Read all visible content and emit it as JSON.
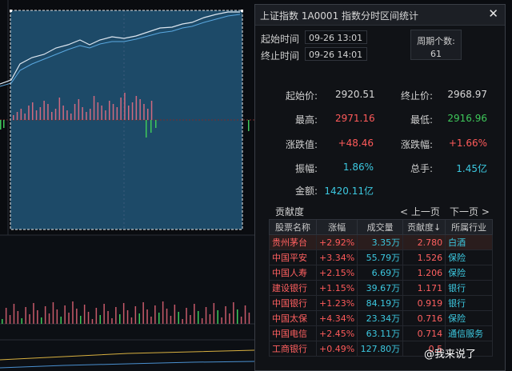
{
  "panel": {
    "title": "上证指数  1A0001  指数分时区间统计",
    "close": "✕",
    "start_label": "起始时间",
    "start_value": "09-26 13:01",
    "end_label": "终止时间",
    "end_value": "09-26 14:01",
    "period_label": "周期个数:",
    "period_value": "61"
  },
  "stats": {
    "start_price_label": "起始价:",
    "start_price": "2920.51",
    "end_price_label": "终止价:",
    "end_price": "2968.97",
    "high_label": "最高:",
    "high": "2971.16",
    "low_label": "最低:",
    "low": "2916.96",
    "change_label": "涨跌值:",
    "change": "+48.46",
    "pct_label": "涨跌幅:",
    "pct": "+1.66%",
    "amp_label": "振幅:",
    "amp": "1.86%",
    "turnover_label": "总手:",
    "turnover": "1.45亿",
    "amount_label": "金额:",
    "amount": "1420.11亿"
  },
  "contrib": {
    "tab": "贡献度",
    "prev": "< 上一页",
    "next": "下一页 >",
    "headers": [
      "股票名称",
      "涨幅",
      "成交量",
      "贡献度↓",
      "所属行业"
    ],
    "rows": [
      {
        "name": "贵州茅台",
        "pct": "+2.92%",
        "vol": "3.35万",
        "contrib": "2.780",
        "ind": "白酒"
      },
      {
        "name": "中国平安",
        "pct": "+3.34%",
        "vol": "55.79万",
        "contrib": "1.526",
        "ind": "保险"
      },
      {
        "name": "中国人寿",
        "pct": "+2.15%",
        "vol": "6.69万",
        "contrib": "1.206",
        "ind": "保险"
      },
      {
        "name": "建设银行",
        "pct": "+1.15%",
        "vol": "39.67万",
        "contrib": "1.171",
        "ind": "银行"
      },
      {
        "name": "中国银行",
        "pct": "+1.23%",
        "vol": "84.19万",
        "contrib": "0.919",
        "ind": "银行"
      },
      {
        "name": "中国太保",
        "pct": "+4.34%",
        "vol": "23.34万",
        "contrib": "0.716",
        "ind": "保险"
      },
      {
        "name": "中国电信",
        "pct": "+2.45%",
        "vol": "63.11万",
        "contrib": "0.714",
        "ind": "通信服务"
      },
      {
        "name": "工商银行",
        "pct": "+0.49%",
        "vol": "127.80万",
        "contrib": "0.5",
        "ind": ""
      }
    ]
  },
  "watermark": "@我来说了",
  "colors": {
    "up": "#ff5a5a",
    "down": "#3ec85a",
    "accent": "#3cc8e0",
    "selection": "#1f5070"
  }
}
